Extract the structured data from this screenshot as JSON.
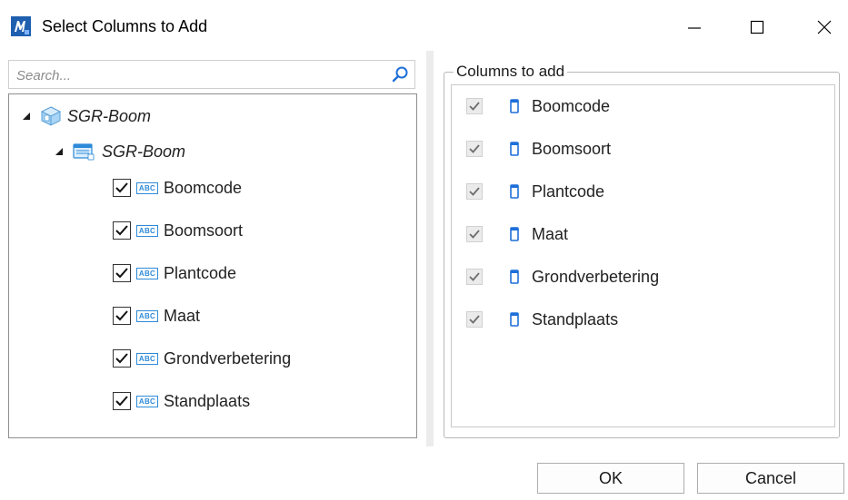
{
  "window": {
    "title": "Select Columns to Add",
    "app_icon": "microstation-icon",
    "controls": [
      "minimize-icon",
      "maximize-icon",
      "close-icon"
    ]
  },
  "search": {
    "placeholder": "Search...",
    "value": ""
  },
  "tree": {
    "root": {
      "label": "SGR-Boom",
      "expanded": true,
      "icon": "database-icon"
    },
    "table": {
      "label": "SGR-Boom",
      "expanded": true,
      "icon": "table-icon"
    },
    "fields": [
      {
        "label": "Boomcode",
        "checked": true,
        "type_icon": "ABC"
      },
      {
        "label": "Boomsoort",
        "checked": true,
        "type_icon": "ABC"
      },
      {
        "label": "Plantcode",
        "checked": true,
        "type_icon": "ABC"
      },
      {
        "label": "Maat",
        "checked": true,
        "type_icon": "ABC"
      },
      {
        "label": "Grondverbetering",
        "checked": true,
        "type_icon": "ABC"
      },
      {
        "label": "Standplaats",
        "checked": true,
        "type_icon": "ABC"
      }
    ]
  },
  "columns_to_add": {
    "legend": "Columns to add",
    "items": [
      {
        "label": "Boomcode",
        "checked": true
      },
      {
        "label": "Boomsoort",
        "checked": true
      },
      {
        "label": "Plantcode",
        "checked": true
      },
      {
        "label": "Maat",
        "checked": true
      },
      {
        "label": "Grondverbetering",
        "checked": true
      },
      {
        "label": "Standplaats",
        "checked": true
      }
    ]
  },
  "buttons": {
    "ok": "OK",
    "cancel": "Cancel"
  },
  "colors": {
    "accent": "#2e8ad8",
    "icon_blue": "#1e6fd9"
  }
}
